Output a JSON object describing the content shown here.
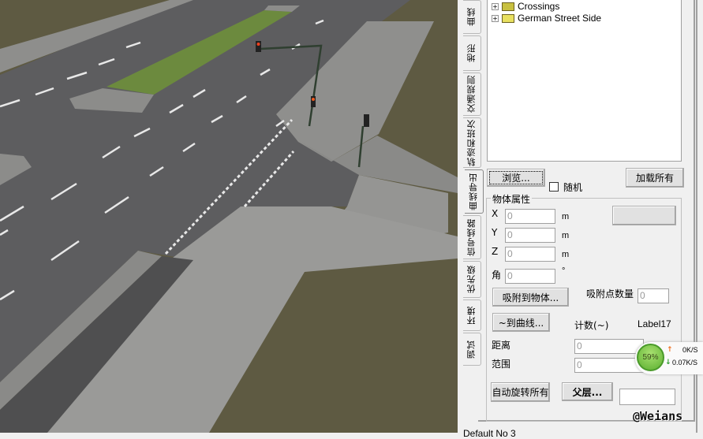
{
  "tabs": [
    "曲线",
    "地形",
    "交通规则",
    "轨迹和班次",
    "曲线导出",
    "信号线路",
    "优先级",
    "环境",
    "调试"
  ],
  "tree": {
    "items": [
      {
        "label": "Crossings",
        "icon": "folder-icon"
      },
      {
        "label": "German Street Side",
        "icon": "folder-open-icon"
      }
    ]
  },
  "buttons": {
    "browse": "浏览...",
    "load_all": "加载所有",
    "snap_object": "吸附到物体...",
    "to_curve": "~到曲线...",
    "auto_rotate": "自动旋转所有",
    "parent": "父层...",
    "blank": ""
  },
  "random_checkbox": {
    "label": "随机",
    "checked": false
  },
  "object_props": {
    "title": "物体属性",
    "x": {
      "label": "X",
      "value": "0",
      "unit": "m"
    },
    "y": {
      "label": "Y",
      "value": "0",
      "unit": "m"
    },
    "z": {
      "label": "Z",
      "value": "0",
      "unit": "m"
    },
    "angle": {
      "label": "角",
      "value": "0",
      "unit": "°"
    },
    "snap_count": {
      "label": "吸附点数量",
      "value": "0"
    },
    "count_label": "计数(~)",
    "label17": "Label17",
    "distance": {
      "label": "距离",
      "value": "0",
      "unit": "m"
    },
    "range": {
      "label": "范围",
      "value": "0",
      "unit": "m"
    },
    "extra_value": ""
  },
  "network_widget": {
    "percent": "59%",
    "upload": "0K/S",
    "download": "0.07K/S",
    "colors": {
      "circle": "#6cc23a",
      "up": "#f07020",
      "down": "#2a9a2a"
    }
  },
  "watermark": "@Weians",
  "status": "Default No 3"
}
